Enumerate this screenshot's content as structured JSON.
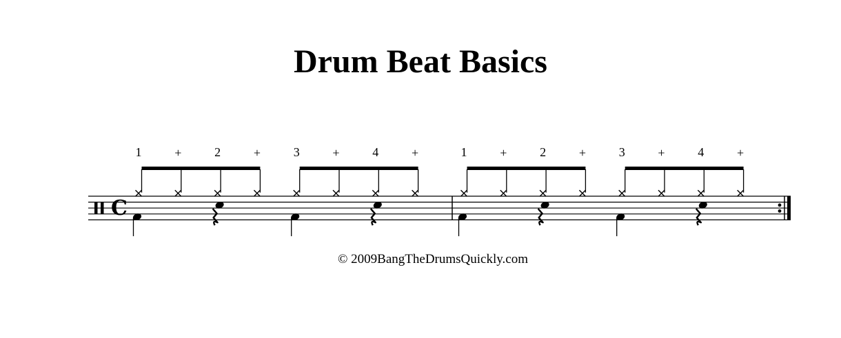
{
  "title": "Drum Beat Basics",
  "copyright": "© 2009BangTheDrumsQuickly.com",
  "time_signature": "C",
  "clef": "percussion",
  "end_barline": "repeat",
  "measures": [
    {
      "counts": [
        "1",
        "+",
        "2",
        "+",
        "3",
        "+",
        "4",
        "+"
      ],
      "hihat": [
        true,
        true,
        true,
        true,
        true,
        true,
        true,
        true
      ],
      "snare": [
        false,
        false,
        true,
        false,
        false,
        false,
        true,
        false
      ],
      "bass": [
        true,
        false,
        false,
        false,
        true,
        false,
        false,
        false
      ],
      "rests": [
        false,
        false,
        true,
        false,
        false,
        false,
        true,
        false
      ]
    },
    {
      "counts": [
        "1",
        "+",
        "2",
        "+",
        "3",
        "+",
        "4",
        "+"
      ],
      "hihat": [
        true,
        true,
        true,
        true,
        true,
        true,
        true,
        true
      ],
      "snare": [
        false,
        false,
        true,
        false,
        false,
        false,
        true,
        false
      ],
      "bass": [
        true,
        false,
        false,
        false,
        true,
        false,
        false,
        false
      ],
      "rests": [
        false,
        false,
        true,
        false,
        false,
        false,
        true,
        false
      ]
    }
  ]
}
